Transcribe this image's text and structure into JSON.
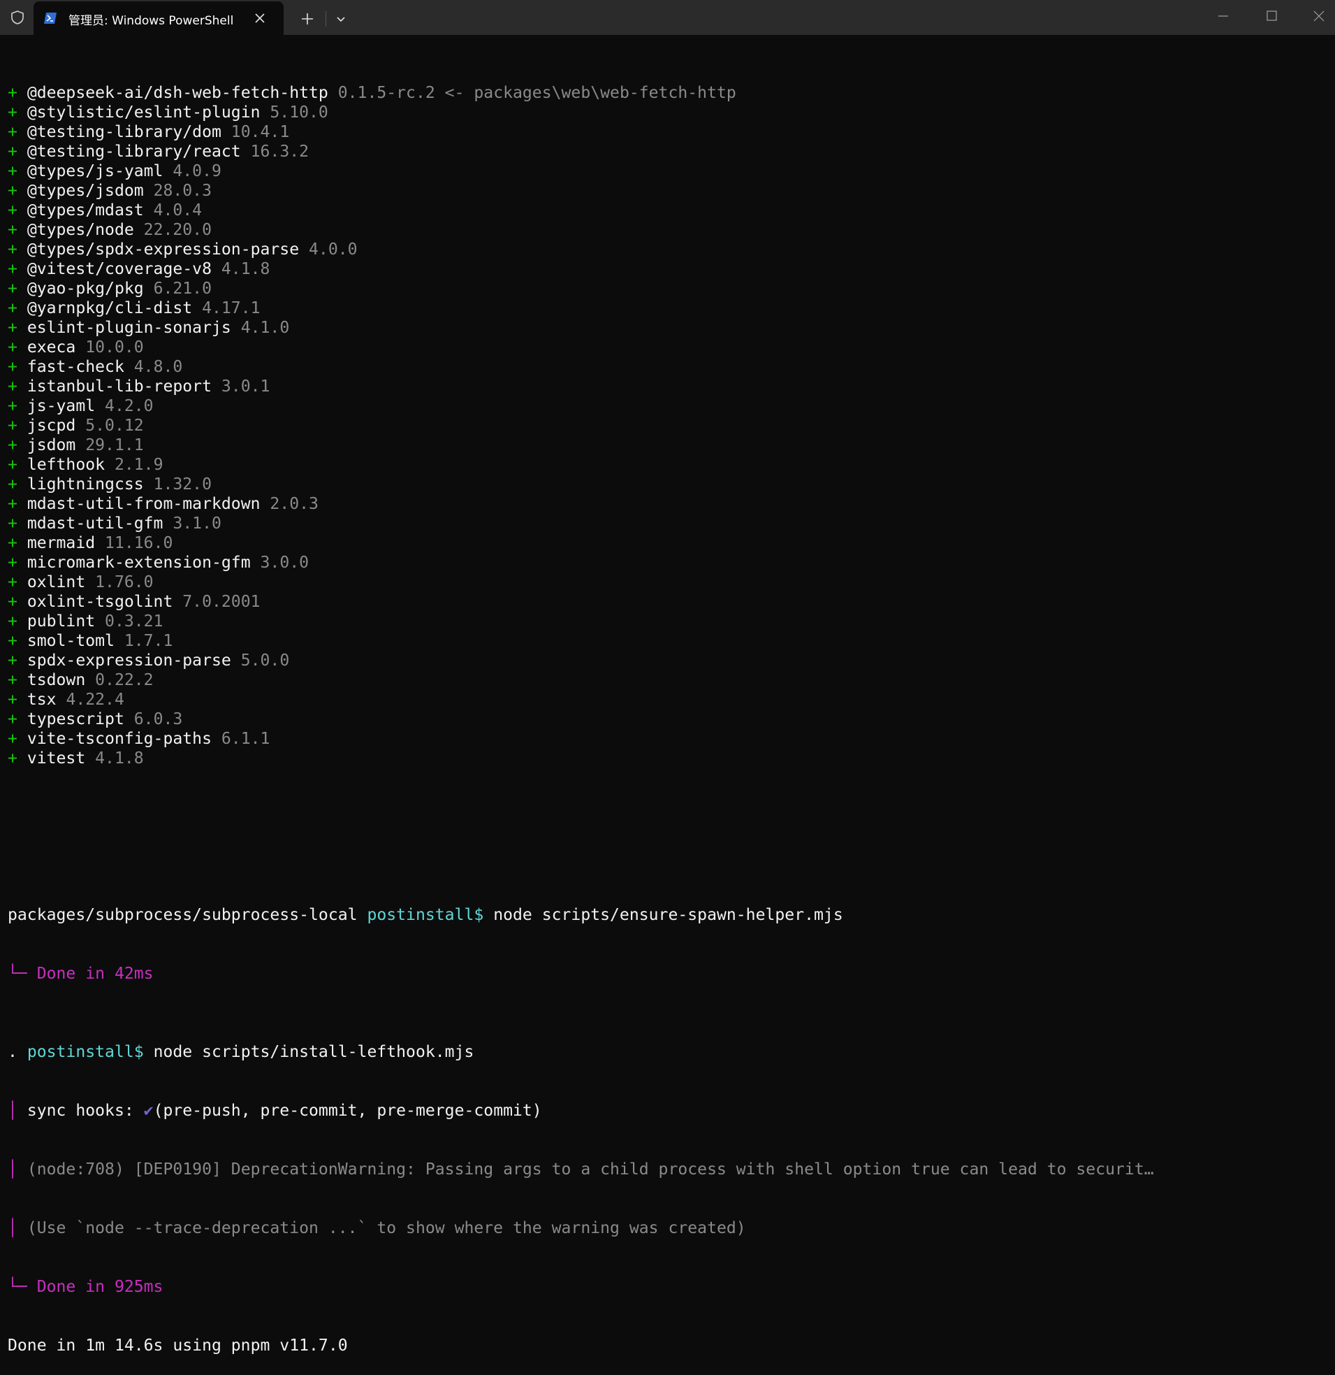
{
  "titlebar": {
    "tab_title": "管理员: Windows PowerShell",
    "accent": "#2b2b2b"
  },
  "packages": [
    {
      "name": "@deepseek-ai/dsh-web-fetch-http",
      "version": "0.1.5-rc.2 <- packages\\web\\web-fetch-http"
    },
    {
      "name": "@stylistic/eslint-plugin",
      "version": "5.10.0"
    },
    {
      "name": "@testing-library/dom",
      "version": "10.4.1"
    },
    {
      "name": "@testing-library/react",
      "version": "16.3.2"
    },
    {
      "name": "@types/js-yaml",
      "version": "4.0.9"
    },
    {
      "name": "@types/jsdom",
      "version": "28.0.3"
    },
    {
      "name": "@types/mdast",
      "version": "4.0.4"
    },
    {
      "name": "@types/node",
      "version": "22.20.0"
    },
    {
      "name": "@types/spdx-expression-parse",
      "version": "4.0.0"
    },
    {
      "name": "@vitest/coverage-v8",
      "version": "4.1.8"
    },
    {
      "name": "@yao-pkg/pkg",
      "version": "6.21.0"
    },
    {
      "name": "@yarnpkg/cli-dist",
      "version": "4.17.1"
    },
    {
      "name": "eslint-plugin-sonarjs",
      "version": "4.1.0"
    },
    {
      "name": "execa",
      "version": "10.0.0"
    },
    {
      "name": "fast-check",
      "version": "4.8.0"
    },
    {
      "name": "istanbul-lib-report",
      "version": "3.0.1"
    },
    {
      "name": "js-yaml",
      "version": "4.2.0"
    },
    {
      "name": "jscpd",
      "version": "5.0.12"
    },
    {
      "name": "jsdom",
      "version": "29.1.1"
    },
    {
      "name": "lefthook",
      "version": "2.1.9"
    },
    {
      "name": "lightningcss",
      "version": "1.32.0"
    },
    {
      "name": "mdast-util-from-markdown",
      "version": "2.0.3"
    },
    {
      "name": "mdast-util-gfm",
      "version": "3.1.0"
    },
    {
      "name": "mermaid",
      "version": "11.16.0"
    },
    {
      "name": "micromark-extension-gfm",
      "version": "3.0.0"
    },
    {
      "name": "oxlint",
      "version": "1.76.0"
    },
    {
      "name": "oxlint-tsgolint",
      "version": "7.0.2001"
    },
    {
      "name": "publint",
      "version": "0.3.21"
    },
    {
      "name": "smol-toml",
      "version": "1.7.1"
    },
    {
      "name": "spdx-expression-parse",
      "version": "5.0.0"
    },
    {
      "name": "tsdown",
      "version": "0.22.2"
    },
    {
      "name": "tsx",
      "version": "4.22.4"
    },
    {
      "name": "typescript",
      "version": "6.0.3"
    },
    {
      "name": "vite-tsconfig-paths",
      "version": "6.1.1"
    },
    {
      "name": "vitest",
      "version": "4.1.8"
    }
  ],
  "plus_sign": "+",
  "postinstall1": {
    "path": "packages/subprocess/subprocess-local",
    "script": "postinstall$",
    "command": "node scripts/ensure-spawn-helper.mjs",
    "done": "└─ Done in 42ms"
  },
  "postinstall2": {
    "path": ".",
    "script": "postinstall$",
    "command": "node scripts/install-lefthook.mjs",
    "bar": "│",
    "sync_label": "sync hooks: ",
    "check": "✔",
    "sync_hooks": "(pre-push, pre-commit, pre-merge-commit)",
    "warning": "(node:708) [DEP0190] DeprecationWarning: Passing args to a child process with shell option true can lead to securit…",
    "trace": "(Use `node --trace-deprecation ...` to show where the warning was created)",
    "done": "└─ Done in 925ms"
  },
  "summary": "Done in 1m 14.6s using pnpm v11.7.0"
}
